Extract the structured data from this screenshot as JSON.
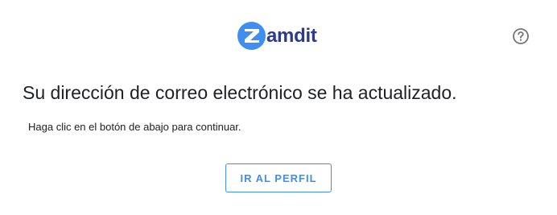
{
  "header": {
    "logo_text": "amdit",
    "logo_icon": "zamdit-z-logo-icon",
    "help_icon": "help-circle-icon"
  },
  "main": {
    "title": "Su dirección de correo electrónico se ha actualizado.",
    "subtitle": "Haga clic en el botón de abajo para continuar.",
    "button_label": "IR AL PERFIL"
  },
  "colors": {
    "brand_blue": "#3f8ef0",
    "logo_text": "#2b3a8c",
    "text": "#202124",
    "help_icon": "#757575"
  }
}
